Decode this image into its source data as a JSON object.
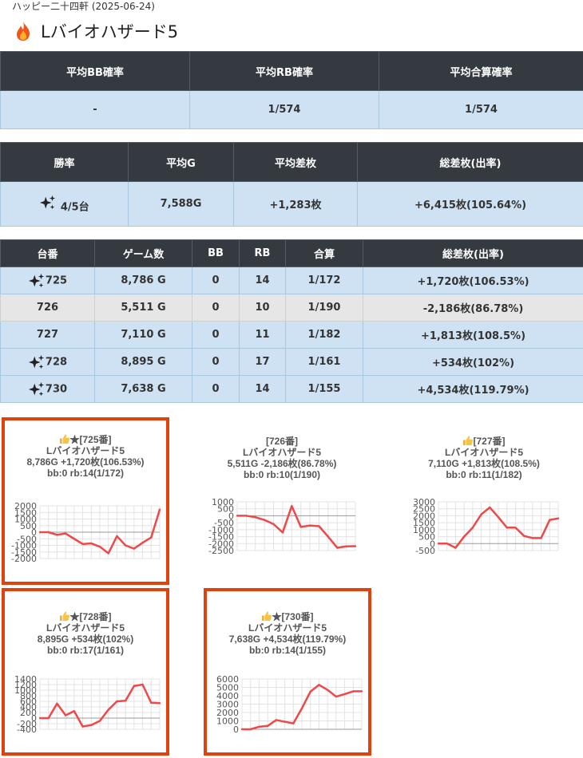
{
  "header": {
    "subtitle": "ハッピー二十四軒 (2025-06-24)",
    "title": "Lバイオハザード5"
  },
  "summary1": {
    "headers": [
      "平均BB確率",
      "平均RB確率",
      "平均合算確率"
    ],
    "values": [
      "-",
      "1/574",
      "1/574"
    ]
  },
  "summary2": {
    "headers": [
      "勝率",
      "平均G",
      "平均差枚",
      "総差枚(出率)"
    ],
    "win_rate": "4/5台",
    "avg_games": "7,588G",
    "avg_diff": "+1,283枚",
    "total_diff": "+6,415枚(105.64%)"
  },
  "machines": {
    "headers": [
      "台番",
      "ゲーム数",
      "BB",
      "RB",
      "合算",
      "総差枚(出率)"
    ],
    "rows": [
      {
        "no": "725",
        "games": "8,786 G",
        "bb": "0",
        "rb": "14",
        "total": "1/172",
        "diff": "+1,720枚(106.53%)",
        "sparkle": true
      },
      {
        "no": "726",
        "games": "5,511 G",
        "bb": "0",
        "rb": "10",
        "total": "1/190",
        "diff": "-2,186枚(86.78%)",
        "sparkle": false
      },
      {
        "no": "727",
        "games": "7,110 G",
        "bb": "0",
        "rb": "11",
        "total": "1/182",
        "diff": "+1,813枚(108.5%)",
        "sparkle": false
      },
      {
        "no": "728",
        "games": "8,895 G",
        "bb": "0",
        "rb": "17",
        "total": "1/161",
        "diff": "+534枚(102%)",
        "sparkle": true
      },
      {
        "no": "730",
        "games": "7,638 G",
        "bb": "0",
        "rb": "14",
        "total": "1/155",
        "diff": "+4,534枚(119.79%)",
        "sparkle": true
      }
    ]
  },
  "cards": [
    {
      "line1": "★[725番]",
      "line2": "Lバイオハザード5",
      "line3": "8,786G +1,720枚(106.53%)",
      "line4": "bb:0 rb:14(1/172)",
      "thumb": true
    },
    {
      "line1": "[726番]",
      "line2": "Lバイオハザード5",
      "line3": "5,511G -2,186枚(86.78%)",
      "line4": "bb:0 rb:10(1/190)",
      "thumb": false
    },
    {
      "line1": "[727番]",
      "line2": "Lバイオハザード5",
      "line3": "7,110G +1,813枚(108.5%)",
      "line4": "bb:0 rb:11(1/182)",
      "thumb": true
    },
    {
      "line1": "★[728番]",
      "line2": "Lバイオハザード5",
      "line3": "8,895G +534枚(102%)",
      "line4": "bb:0 rb:17(1/161)",
      "thumb": true
    },
    {
      "line1": "★[730番]",
      "line2": "Lバイオハザード5",
      "line3": "7,638G +4,534枚(119.79%)",
      "line4": "bb:0 rb:14(1/155)",
      "thumb": true
    }
  ],
  "chart_data": [
    {
      "type": "line",
      "color": "#f04848",
      "ylim": [
        -2000,
        2000
      ],
      "yticks": [
        2000,
        1500,
        1000,
        500,
        0,
        -500,
        -1000,
        -1500,
        -2000
      ],
      "values": [
        0,
        0,
        -200,
        -100,
        -500,
        -900,
        -850,
        -1100,
        -1600,
        -300,
        -1000,
        -1250,
        -800,
        -400,
        1720
      ]
    },
    {
      "type": "line",
      "color": "#f04848",
      "ylim": [
        -2500,
        1000
      ],
      "yticks": [
        1000,
        500,
        0,
        -500,
        -1000,
        -1500,
        -2000,
        -2500
      ],
      "values": [
        0,
        0,
        -100,
        -300,
        -600,
        -1200,
        700,
        -800,
        -700,
        -750,
        -1500,
        -2300,
        -2200,
        -2186
      ]
    },
    {
      "type": "line",
      "color": "#f04848",
      "ylim": [
        -500,
        3000
      ],
      "yticks": [
        3000,
        2500,
        2000,
        1500,
        1000,
        500,
        0,
        -500
      ],
      "values": [
        0,
        0,
        -300,
        500,
        1150,
        2100,
        2600,
        1900,
        1150,
        1150,
        550,
        400,
        400,
        1700,
        1813
      ]
    },
    {
      "type": "line",
      "color": "#f04848",
      "ylim": [
        -400,
        1400
      ],
      "yticks": [
        1400,
        1200,
        1000,
        800,
        600,
        400,
        200,
        0,
        -200,
        -400
      ],
      "values": [
        0,
        0,
        520,
        100,
        250,
        -300,
        -250,
        -100,
        300,
        600,
        620,
        1150,
        1200,
        550,
        534
      ]
    },
    {
      "type": "line",
      "color": "#f04848",
      "ylim": [
        0,
        6000
      ],
      "yticks": [
        6000,
        5000,
        4000,
        3000,
        2000,
        1000,
        0
      ],
      "values": [
        0,
        0,
        300,
        400,
        1100,
        900,
        700,
        2500,
        4500,
        5300,
        4700,
        3900,
        4200,
        4534,
        4534
      ]
    }
  ]
}
